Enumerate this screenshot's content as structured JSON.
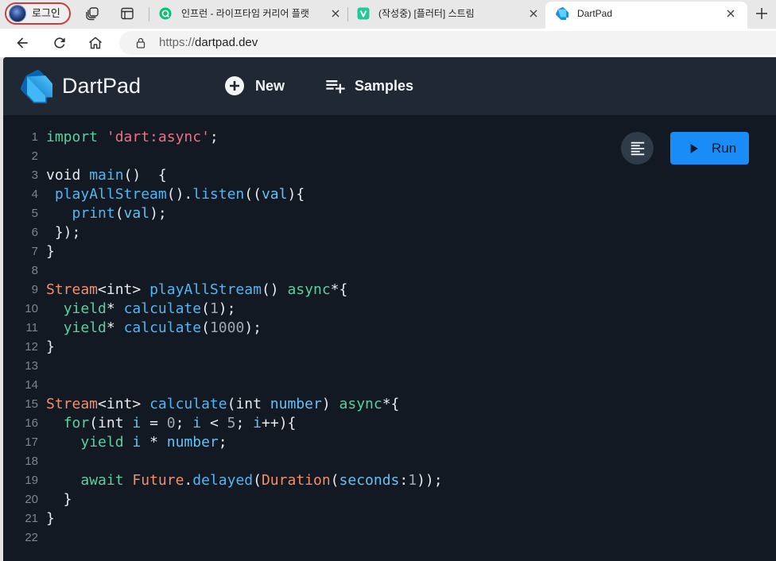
{
  "browser": {
    "profile_label": "로그인",
    "tabs": [
      {
        "title": "인프런 - 라이프타임 커리어 플랫",
        "active": false,
        "favicon": "inflearn-icon"
      },
      {
        "title": "(작성중) [플러터] 스트림",
        "active": false,
        "favicon": "velog-icon"
      },
      {
        "title": "DartPad",
        "active": true,
        "favicon": "dartpad-icon"
      }
    ],
    "url_scheme": "https://",
    "url_host": "dartpad.dev"
  },
  "app": {
    "title": "DartPad",
    "new_label": "New",
    "samples_label": "Samples",
    "run_label": "Run"
  },
  "theme": {
    "header_bg": "#1f2833",
    "editor_bg": "#121922",
    "run_bg": "#1a8cf7",
    "format_bg": "#2f3b49",
    "profile_border": "#c8403e"
  },
  "editor": {
    "lines": [
      {
        "n": 1,
        "tokens": [
          [
            "import",
            "#5ccf9f"
          ],
          [
            " ",
            "#e8eaed"
          ],
          [
            "'dart:async'",
            "#ef6f85"
          ],
          [
            ";",
            "#e8eaed"
          ]
        ]
      },
      {
        "n": 2,
        "tokens": []
      },
      {
        "n": 3,
        "tokens": [
          [
            "void ",
            "#e8eaed"
          ],
          [
            "main",
            "#52b6f2"
          ],
          [
            "()  {",
            "#e8eaed"
          ]
        ]
      },
      {
        "n": 4,
        "tokens": [
          [
            " ",
            "#e8eaed"
          ],
          [
            "playAllStream",
            "#52b6f2"
          ],
          [
            "().",
            "#e8eaed"
          ],
          [
            "listen",
            "#52b6f2"
          ],
          [
            "((",
            "#e8eaed"
          ],
          [
            "val",
            "#65c0f4"
          ],
          [
            "){",
            "#e8eaed"
          ]
        ]
      },
      {
        "n": 5,
        "tokens": [
          [
            "   ",
            "#e8eaed"
          ],
          [
            "print",
            "#52b6f2"
          ],
          [
            "(",
            "#e8eaed"
          ],
          [
            "val",
            "#65c0f4"
          ],
          [
            ");",
            "#e8eaed"
          ]
        ]
      },
      {
        "n": 6,
        "tokens": [
          [
            " });",
            "#e8eaed"
          ]
        ]
      },
      {
        "n": 7,
        "tokens": [
          [
            "}",
            "#e8eaed"
          ]
        ]
      },
      {
        "n": 8,
        "tokens": []
      },
      {
        "n": 9,
        "tokens": [
          [
            "Stream",
            "#f58d69"
          ],
          [
            "<int> ",
            "#e8eaed"
          ],
          [
            "playAllStream",
            "#52b6f2"
          ],
          [
            "() ",
            "#e8eaed"
          ],
          [
            "async",
            "#5ccf9f"
          ],
          [
            "*{",
            "#e8eaed"
          ]
        ]
      },
      {
        "n": 10,
        "tokens": [
          [
            "  ",
            "#e8eaed"
          ],
          [
            "yield",
            "#5ccf9f"
          ],
          [
            "* ",
            "#e8eaed"
          ],
          [
            "calculate",
            "#52b6f2"
          ],
          [
            "(",
            "#e8eaed"
          ],
          [
            "1",
            "#a1a7ae"
          ],
          [
            ");",
            "#e8eaed"
          ]
        ]
      },
      {
        "n": 11,
        "tokens": [
          [
            "  ",
            "#e8eaed"
          ],
          [
            "yield",
            "#5ccf9f"
          ],
          [
            "* ",
            "#e8eaed"
          ],
          [
            "calculate",
            "#52b6f2"
          ],
          [
            "(",
            "#e8eaed"
          ],
          [
            "1000",
            "#a1a7ae"
          ],
          [
            ");",
            "#e8eaed"
          ]
        ]
      },
      {
        "n": 12,
        "tokens": [
          [
            "}",
            "#e8eaed"
          ]
        ]
      },
      {
        "n": 13,
        "tokens": []
      },
      {
        "n": 14,
        "tokens": []
      },
      {
        "n": 15,
        "tokens": [
          [
            "Stream",
            "#f58d69"
          ],
          [
            "<int> ",
            "#e8eaed"
          ],
          [
            "calculate",
            "#52b6f2"
          ],
          [
            "(int ",
            "#e8eaed"
          ],
          [
            "number",
            "#65c0f4"
          ],
          [
            ") ",
            "#e8eaed"
          ],
          [
            "async",
            "#5ccf9f"
          ],
          [
            "*{",
            "#e8eaed"
          ]
        ]
      },
      {
        "n": 16,
        "tokens": [
          [
            "  ",
            "#e8eaed"
          ],
          [
            "for",
            "#5ccf9f"
          ],
          [
            "(int ",
            "#e8eaed"
          ],
          [
            "i",
            "#65c0f4"
          ],
          [
            " = ",
            "#e8eaed"
          ],
          [
            "0",
            "#a1a7ae"
          ],
          [
            "; ",
            "#e8eaed"
          ],
          [
            "i",
            "#65c0f4"
          ],
          [
            " < ",
            "#e8eaed"
          ],
          [
            "5",
            "#a1a7ae"
          ],
          [
            "; ",
            "#e8eaed"
          ],
          [
            "i",
            "#65c0f4"
          ],
          [
            "++){",
            "#e8eaed"
          ]
        ]
      },
      {
        "n": 17,
        "tokens": [
          [
            "    ",
            "#e8eaed"
          ],
          [
            "yield",
            "#5ccf9f"
          ],
          [
            " ",
            "#e8eaed"
          ],
          [
            "i",
            "#65c0f4"
          ],
          [
            " * ",
            "#e8eaed"
          ],
          [
            "number",
            "#65c0f4"
          ],
          [
            ";",
            "#e8eaed"
          ]
        ]
      },
      {
        "n": 18,
        "tokens": []
      },
      {
        "n": 19,
        "tokens": [
          [
            "    ",
            "#e8eaed"
          ],
          [
            "await",
            "#5ccf9f"
          ],
          [
            " ",
            "#e8eaed"
          ],
          [
            "Future",
            "#f58d69"
          ],
          [
            ".",
            "#e8eaed"
          ],
          [
            "delayed",
            "#52b6f2"
          ],
          [
            "(",
            "#e8eaed"
          ],
          [
            "Duration",
            "#f58d69"
          ],
          [
            "(",
            "#e8eaed"
          ],
          [
            "seconds",
            "#65c0f4"
          ],
          [
            ":",
            "#e8eaed"
          ],
          [
            "1",
            "#a1a7ae"
          ],
          [
            "));",
            "#e8eaed"
          ]
        ]
      },
      {
        "n": 20,
        "tokens": [
          [
            "  }",
            "#e8eaed"
          ]
        ]
      },
      {
        "n": 21,
        "tokens": [
          [
            "}",
            "#e8eaed"
          ]
        ]
      },
      {
        "n": 22,
        "tokens": []
      }
    ]
  }
}
